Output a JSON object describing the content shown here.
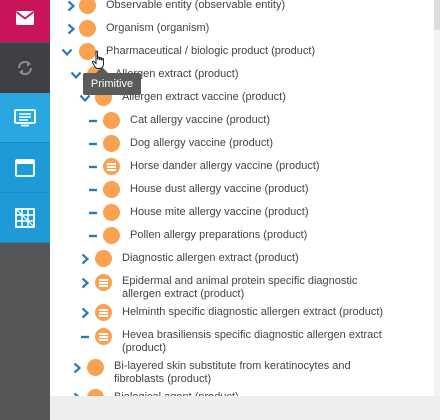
{
  "colors": {
    "accent_mail": "#c8155a",
    "accent_blue": "#29a7e1",
    "node_orange": "#f8a252",
    "toggle_blue": "#2a7ab8",
    "sidebar_gray": "#555657"
  },
  "sidebar": {
    "items": [
      {
        "icon": "mail-icon"
      },
      {
        "icon": "sync-icon"
      },
      {
        "icon": "classification-view-icon"
      },
      {
        "icon": "window-icon"
      },
      {
        "icon": "grid-icon"
      }
    ]
  },
  "tree": {
    "nodes": [
      {
        "label": "Observable entity (observable entity)",
        "toggle": "collapsed",
        "node_type": "primitive"
      },
      {
        "label": "Organism (organism)",
        "toggle": "collapsed",
        "node_type": "primitive"
      },
      {
        "label": "Pharmaceutical / biologic product (product)",
        "toggle": "expanded",
        "node_type": "primitive"
      },
      {
        "label": "Allergen extract (product)",
        "toggle": "expanded",
        "node_type": "primitive"
      },
      {
        "label": "Allergen extract vaccine (product)",
        "toggle": "expanded",
        "node_type": "primitive"
      },
      {
        "label": "Cat allergy vaccine (product)",
        "toggle": "leaf",
        "node_type": "primitive"
      },
      {
        "label": "Dog allergy vaccine (product)",
        "toggle": "leaf",
        "node_type": "primitive"
      },
      {
        "label": "Horse dander allergy vaccine (product)",
        "toggle": "leaf",
        "node_type": "fully-defined"
      },
      {
        "label": "House dust allergy vaccine (product)",
        "toggle": "leaf",
        "node_type": "primitive"
      },
      {
        "label": "House mite allergy vaccine (product)",
        "toggle": "leaf",
        "node_type": "primitive"
      },
      {
        "label": "Pollen allergy preparations (product)",
        "toggle": "leaf",
        "node_type": "primitive"
      },
      {
        "label": "Diagnostic allergen extract (product)",
        "toggle": "collapsed",
        "node_type": "primitive"
      },
      {
        "label": "Epidermal and animal protein specific diagnostic allergen extract (product)",
        "toggle": "collapsed",
        "node_type": "fully-defined"
      },
      {
        "label": "Helminth specific diagnostic allergen extract (product)",
        "toggle": "collapsed",
        "node_type": "fully-defined"
      },
      {
        "label": "Hevea brasiliensis specific diagnostic allergen extract (product)",
        "toggle": "leaf",
        "node_type": "fully-defined"
      },
      {
        "label": "Bi-layered skin substitute from keratinocytes and fibroblasts (product)",
        "toggle": "collapsed",
        "node_type": "primitive"
      },
      {
        "label": "Biological agent (product)",
        "toggle": "collapsed",
        "node_type": "primitive"
      }
    ]
  },
  "tooltip": {
    "text": "Primitive"
  }
}
